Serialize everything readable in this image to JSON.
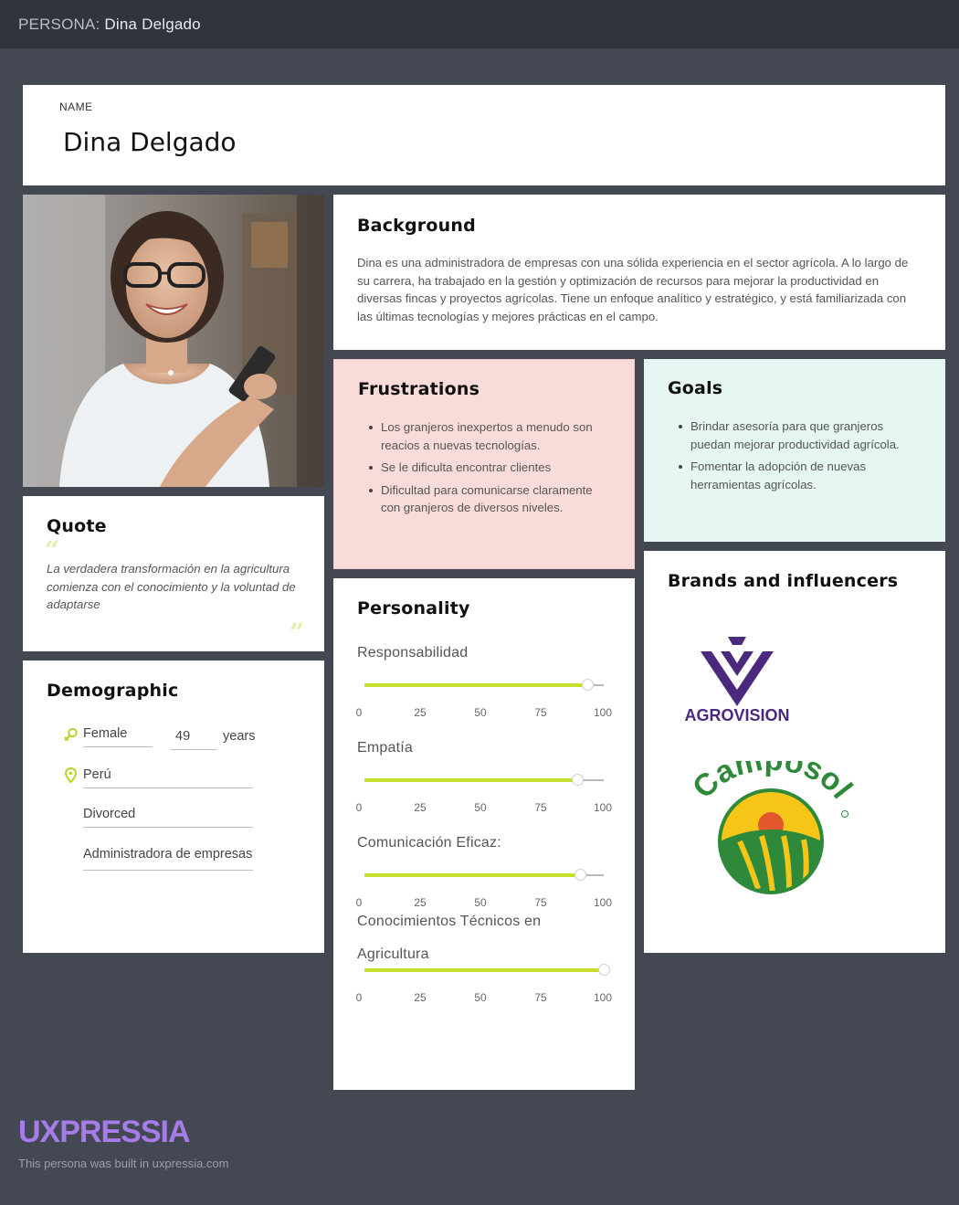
{
  "header": {
    "label": "PERSONA:",
    "name": "Dina Delgado"
  },
  "name_card": {
    "label": "NAME",
    "value": "Dina Delgado"
  },
  "background": {
    "title": "Background",
    "text": "Dina es una administradora de empresas con una sólida experiencia en el sector agrícola. A lo largo de su carrera, ha trabajado en la gestión y optimización de recursos para mejorar la productividad en diversas fincas y proyectos agrícolas. Tiene un enfoque analítico y estratégico, y está familiarizada con las últimas tecnologías y mejores prácticas en el campo."
  },
  "frustrations": {
    "title": "Frustrations",
    "items": [
      "Los granjeros inexpertos a menudo son reacios a nuevas tecnologías.",
      "Se le dificulta encontrar clientes",
      "Dificultad para comunicarse claramente con granjeros de diversos niveles."
    ],
    "bg_color": "#f9dcd9"
  },
  "goals": {
    "title": "Goals",
    "items": [
      "Brindar asesoría para que granjeros puedan mejorar productividad agrícola.",
      "Fomentar la adopción de nuevas herramientas agrícolas."
    ],
    "bg_color": "#e5f6f3"
  },
  "quote": {
    "title": "Quote",
    "text": "La verdadera transformación en la agricultura comienza con el conocimiento y la voluntad de adaptarse"
  },
  "demographic": {
    "title": "Demographic",
    "gender": "Female",
    "age": "49",
    "age_unit": "years",
    "location": "Perú",
    "marital_status": "Divorced",
    "occupation": "Administradora de empresas"
  },
  "personality": {
    "title": "Personality",
    "scale_ticks": [
      "0",
      "25",
      "50",
      "75",
      "100"
    ],
    "accent_color": "#c7de2e",
    "traits": [
      {
        "name": "Responsabilidad",
        "value": 93
      },
      {
        "name": "Empatía",
        "value": 89
      },
      {
        "name": "Comunicación Eficaz:",
        "value": 90
      },
      {
        "name": "Conocimientos Técnicos en Agricultura",
        "value": 100
      }
    ]
  },
  "brands": {
    "title": "Brands and influencers",
    "items": [
      {
        "name": "AGROVISION",
        "color": "#4b2a7d"
      },
      {
        "name": "Camposol",
        "color": "#2e8a3a"
      }
    ]
  },
  "footer": {
    "logo": "UXPRESSIA",
    "note": "This persona was built in uxpressia.com",
    "logo_color": "#a57ce8"
  }
}
